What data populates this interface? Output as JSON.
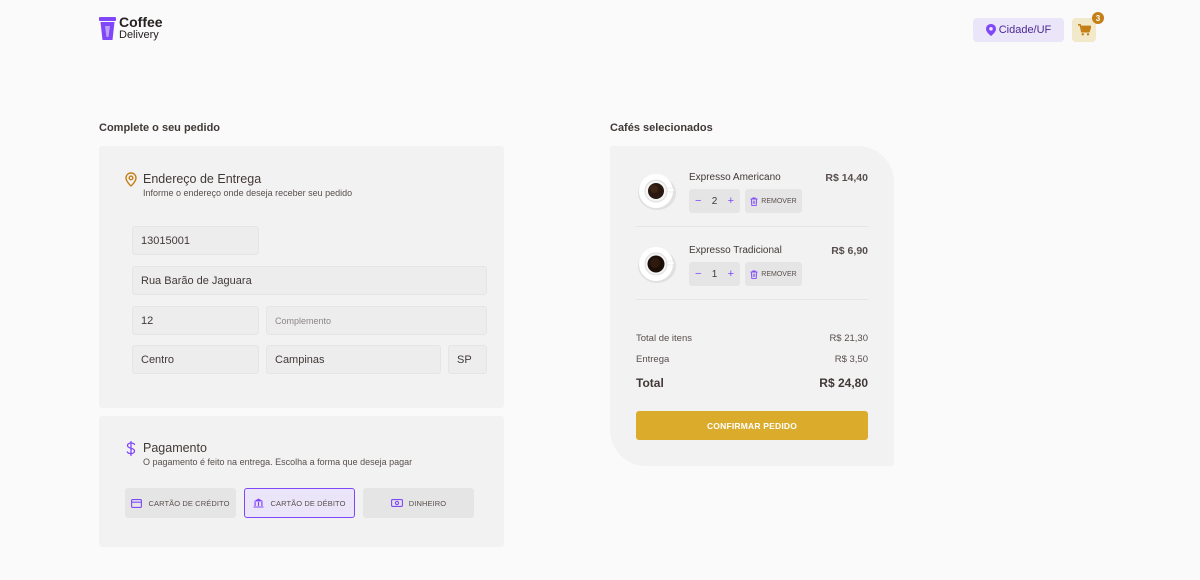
{
  "header": {
    "logo_title": "Coffee",
    "logo_sub": "Delivery",
    "location_label": "Cidade/UF",
    "cart_count": "3"
  },
  "form": {
    "section_title": "Complete o seu pedido",
    "address": {
      "title": "Endereço de Entrega",
      "subtitle": "Informe o endereço onde deseja receber seu pedido",
      "cep": "13015001",
      "street": "Rua Barão de Jaguara",
      "number": "12",
      "complement_placeholder": "Complemento",
      "neighborhood": "Centro",
      "city": "Campinas",
      "uf": "SP"
    },
    "payment": {
      "title": "Pagamento",
      "subtitle": "O pagamento é feito na entrega. Escolha a forma que deseja pagar",
      "options": [
        "CARTÃO DE CRÉDITO",
        "CARTÃO DE DÉBITO",
        "DINHEIRO"
      ],
      "selected": "CARTÃO DE DÉBITO"
    }
  },
  "cart": {
    "section_title": "Cafés selecionados",
    "items": [
      {
        "name": "Expresso Americano",
        "price": "R$ 14,40",
        "quantity": "2",
        "remove_label": "REMOVER"
      },
      {
        "name": "Expresso Tradicional",
        "price": "R$ 6,90",
        "quantity": "1",
        "remove_label": "REMOVER"
      }
    ],
    "summary": {
      "items_label": "Total de itens",
      "items_value": "R$ 21,30",
      "delivery_label": "Entrega",
      "delivery_value": "R$ 3,50",
      "total_label": "Total",
      "total_value": "R$ 24,80"
    },
    "confirm_label": "CONFIRMAR PEDIDO"
  },
  "colors": {
    "purple": "#8047f8",
    "purple_dark": "#4b2995",
    "yellow": "#dbac2c",
    "yellow_dark": "#c47f17"
  },
  "icons": [
    "logo-cup-icon",
    "map-pin-icon",
    "cart-icon",
    "map-pin-outline-icon",
    "dollar-icon",
    "credit-card-icon",
    "bank-icon",
    "money-icon",
    "minus-icon",
    "plus-icon",
    "trash-icon"
  ]
}
